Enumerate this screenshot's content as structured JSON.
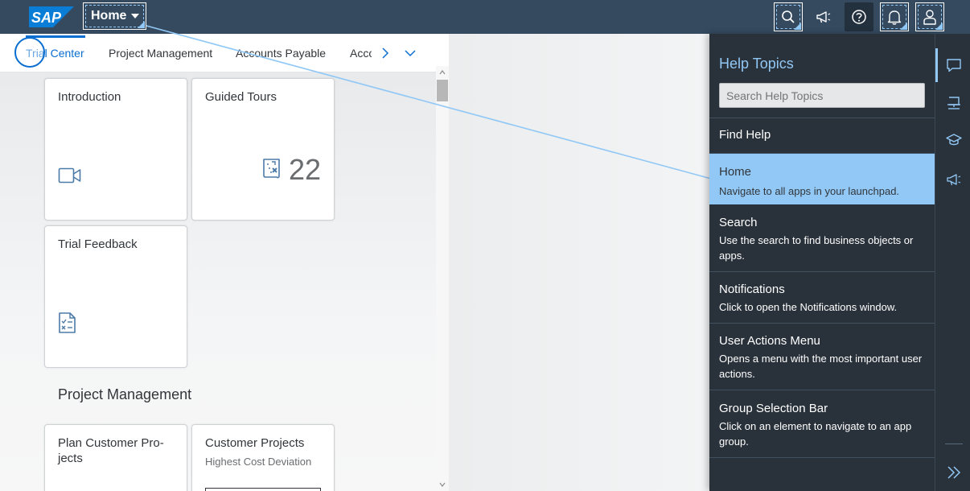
{
  "shell": {
    "logo_text": "SAP",
    "home_label": "Home"
  },
  "tabs": [
    {
      "label": "Trial Center"
    },
    {
      "label": "Project Management"
    },
    {
      "label": "Accounts Payable"
    },
    {
      "label": "Acco"
    }
  ],
  "tiles": {
    "introduction": {
      "title": "Introduction"
    },
    "guided_tours": {
      "title": "Guided Tours",
      "count": "22"
    },
    "trial_feedback": {
      "title": "Trial Feedback"
    },
    "plan_customer_projects": {
      "title": "Plan Customer Pro-jects"
    },
    "customer_projects": {
      "title": "Customer Projects",
      "subtitle": "Highest Cost Deviation"
    }
  },
  "groups": {
    "project_management": "Project Management"
  },
  "help": {
    "title": "Help Topics",
    "search_placeholder": "Search Help Topics",
    "find_help": "Find Help",
    "items": [
      {
        "title": "Home",
        "desc": "Navigate to all apps in your launchpad."
      },
      {
        "title": "Search",
        "desc": "Use the search to find business objects or apps."
      },
      {
        "title": "Notifications",
        "desc": "Click to open the Notifications window."
      },
      {
        "title": "User Actions Menu",
        "desc": "Opens a menu with the most important user actions."
      },
      {
        "title": "Group Selection Bar",
        "desc": "Click on an element to navigate to an app group."
      }
    ]
  },
  "icons": {
    "shellbar": [
      "search-icon",
      "megaphone-icon",
      "help-icon",
      "bell-icon",
      "user-icon"
    ],
    "rail": [
      "chat-icon",
      "presentation-icon",
      "graduation-cap-icon",
      "megaphone-icon",
      "double-chevron-right-icon"
    ]
  },
  "colors": {
    "shell_bg": "#354a5f",
    "accent": "#0a6ed1",
    "help_bg": "#29313a",
    "help_selected": "#91c8f6"
  }
}
